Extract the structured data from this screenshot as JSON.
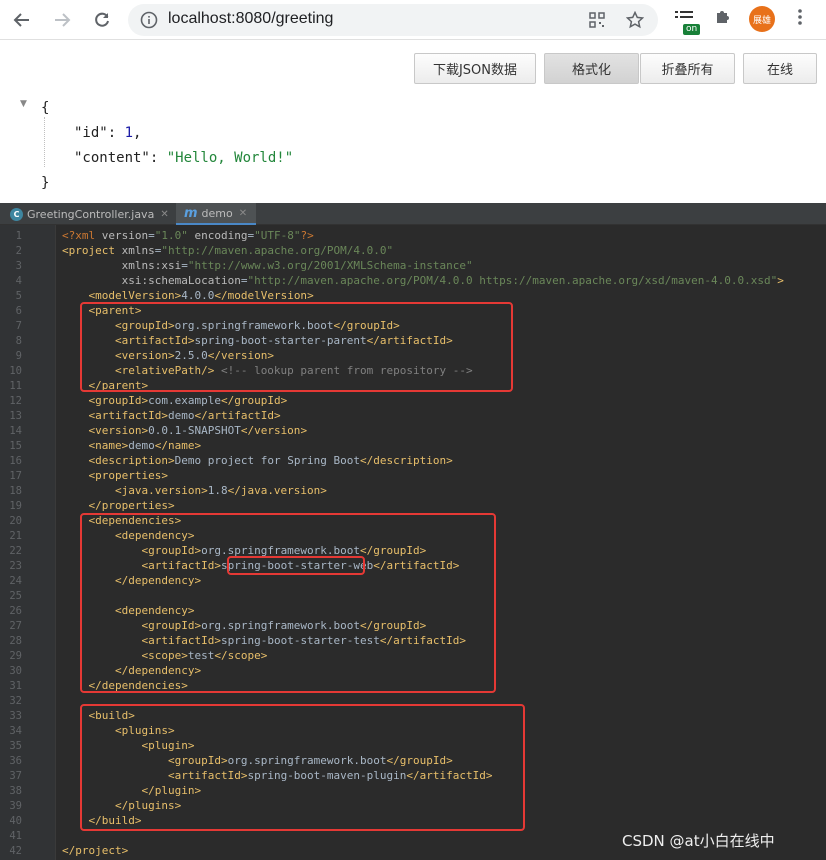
{
  "browser": {
    "url": "localhost:8080/greeting",
    "avatar_label": "展雄",
    "extension_badge": "on"
  },
  "json_viewer": {
    "buttons": [
      {
        "label": "下载JSON数据"
      },
      {
        "label": "格式化"
      },
      {
        "label": "折叠所有"
      },
      {
        "label": "在线"
      }
    ],
    "lines": [
      "{",
      "\"id\": 1,",
      "\"content\": \"Hello, World!\"",
      "}"
    ],
    "response": {
      "id_key": "\"id\"",
      "id_value": "1",
      "content_key": "\"content\"",
      "content_value": "\"Hello, World!\""
    }
  },
  "ide": {
    "tabs": [
      {
        "label": "GreetingController.java",
        "icon": "class-c-icon"
      },
      {
        "label": "demo",
        "icon": "maven-m-icon"
      }
    ],
    "line_numbers": [
      "1",
      "2",
      "3",
      "4",
      "5",
      "6",
      "7",
      "8",
      "9",
      "10",
      "11",
      "12",
      "13",
      "14",
      "15",
      "16",
      "17",
      "18",
      "19",
      "20",
      "21",
      "22",
      "23",
      "24",
      "25",
      "26",
      "27",
      "28",
      "29",
      "30",
      "31",
      "32",
      "33",
      "34",
      "35",
      "36",
      "37",
      "38",
      "39",
      "40",
      "41",
      "42"
    ],
    "code_lines": [
      "<?xml version=\"1.0\" encoding=\"UTF-8\"?>",
      "<project xmlns=\"http://maven.apache.org/POM/4.0.0\"",
      "         xmlns:xsi=\"http://www.w3.org/2001/XMLSchema-instance\"",
      "         xsi:schemaLocation=\"http://maven.apache.org/POM/4.0.0 https://maven.apache.org/xsd/maven-4.0.0.xsd\">",
      "    <modelVersion>4.0.0</modelVersion>",
      "    <parent>",
      "        <groupId>org.springframework.boot</groupId>",
      "        <artifactId>spring-boot-starter-parent</artifactId>",
      "        <version>2.5.0</version>",
      "        <relativePath/> <!-- lookup parent from repository -->",
      "    </parent>",
      "    <groupId>com.example</groupId>",
      "    <artifactId>demo</artifactId>",
      "    <version>0.0.1-SNAPSHOT</version>",
      "    <name>demo</name>",
      "    <description>Demo project for Spring Boot</description>",
      "    <properties>",
      "        <java.version>1.8</java.version>",
      "    </properties>",
      "    <dependencies>",
      "        <dependency>",
      "            <groupId>org.springframework.boot</groupId>",
      "            <artifactId>spring-boot-starter-web</artifactId>",
      "        </dependency>",
      "",
      "        <dependency>",
      "            <groupId>org.springframework.boot</groupId>",
      "            <artifactId>spring-boot-starter-test</artifactId>",
      "            <scope>test</scope>",
      "        </dependency>",
      "    </dependencies>",
      "",
      "    <build>",
      "        <plugins>",
      "            <plugin>",
      "                <groupId>org.springframework.boot</groupId>",
      "                <artifactId>spring-boot-maven-plugin</artifactId>",
      "            </plugin>",
      "        </plugins>",
      "    </build>",
      "",
      "</project>"
    ]
  },
  "watermark": "CSDN @at小白在线中"
}
